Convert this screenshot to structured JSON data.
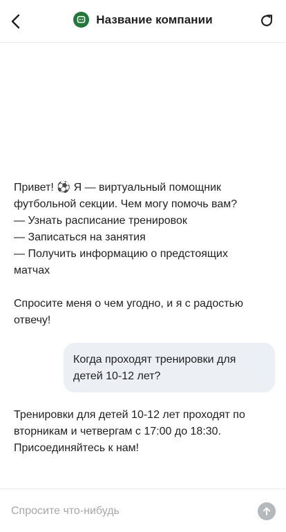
{
  "header": {
    "back_icon": "chevron-left-icon",
    "logo_icon": "chat-bot-logo-icon",
    "title": "Название компании",
    "refresh_icon": "refresh-icon",
    "accent_color": "#1f7a3a"
  },
  "messages": [
    {
      "role": "bot",
      "lines": [
        "Привет! ⚽ Я — виртуальный помощник",
        "футбольной секции. Чем могу помочь вам?",
        "— Узнать расписание тренировок",
        "— Записаться на занятия",
        "— Получить информацию о предстоящих",
        "матчах",
        "",
        "Спросите меня о чем угодно, и я с радостью",
        "отвечу!"
      ]
    },
    {
      "role": "user",
      "lines": [
        "Когда проходят тренировки для",
        "детей 10-12 лет?"
      ]
    },
    {
      "role": "bot",
      "lines": [
        "Тренировки для детей 10-12 лет проходят по",
        "вторникам и четвергам с 17:00 до 18:30.",
        "Присоединяйтесь к нам!"
      ]
    }
  ],
  "input": {
    "value": "",
    "placeholder": "Спросите что-нибудь",
    "send_icon": "arrow-up-send-icon"
  },
  "colors": {
    "user_bubble": "#eceff3",
    "send_button_disabled": "#b5b8bc",
    "divider": "#ececec"
  }
}
